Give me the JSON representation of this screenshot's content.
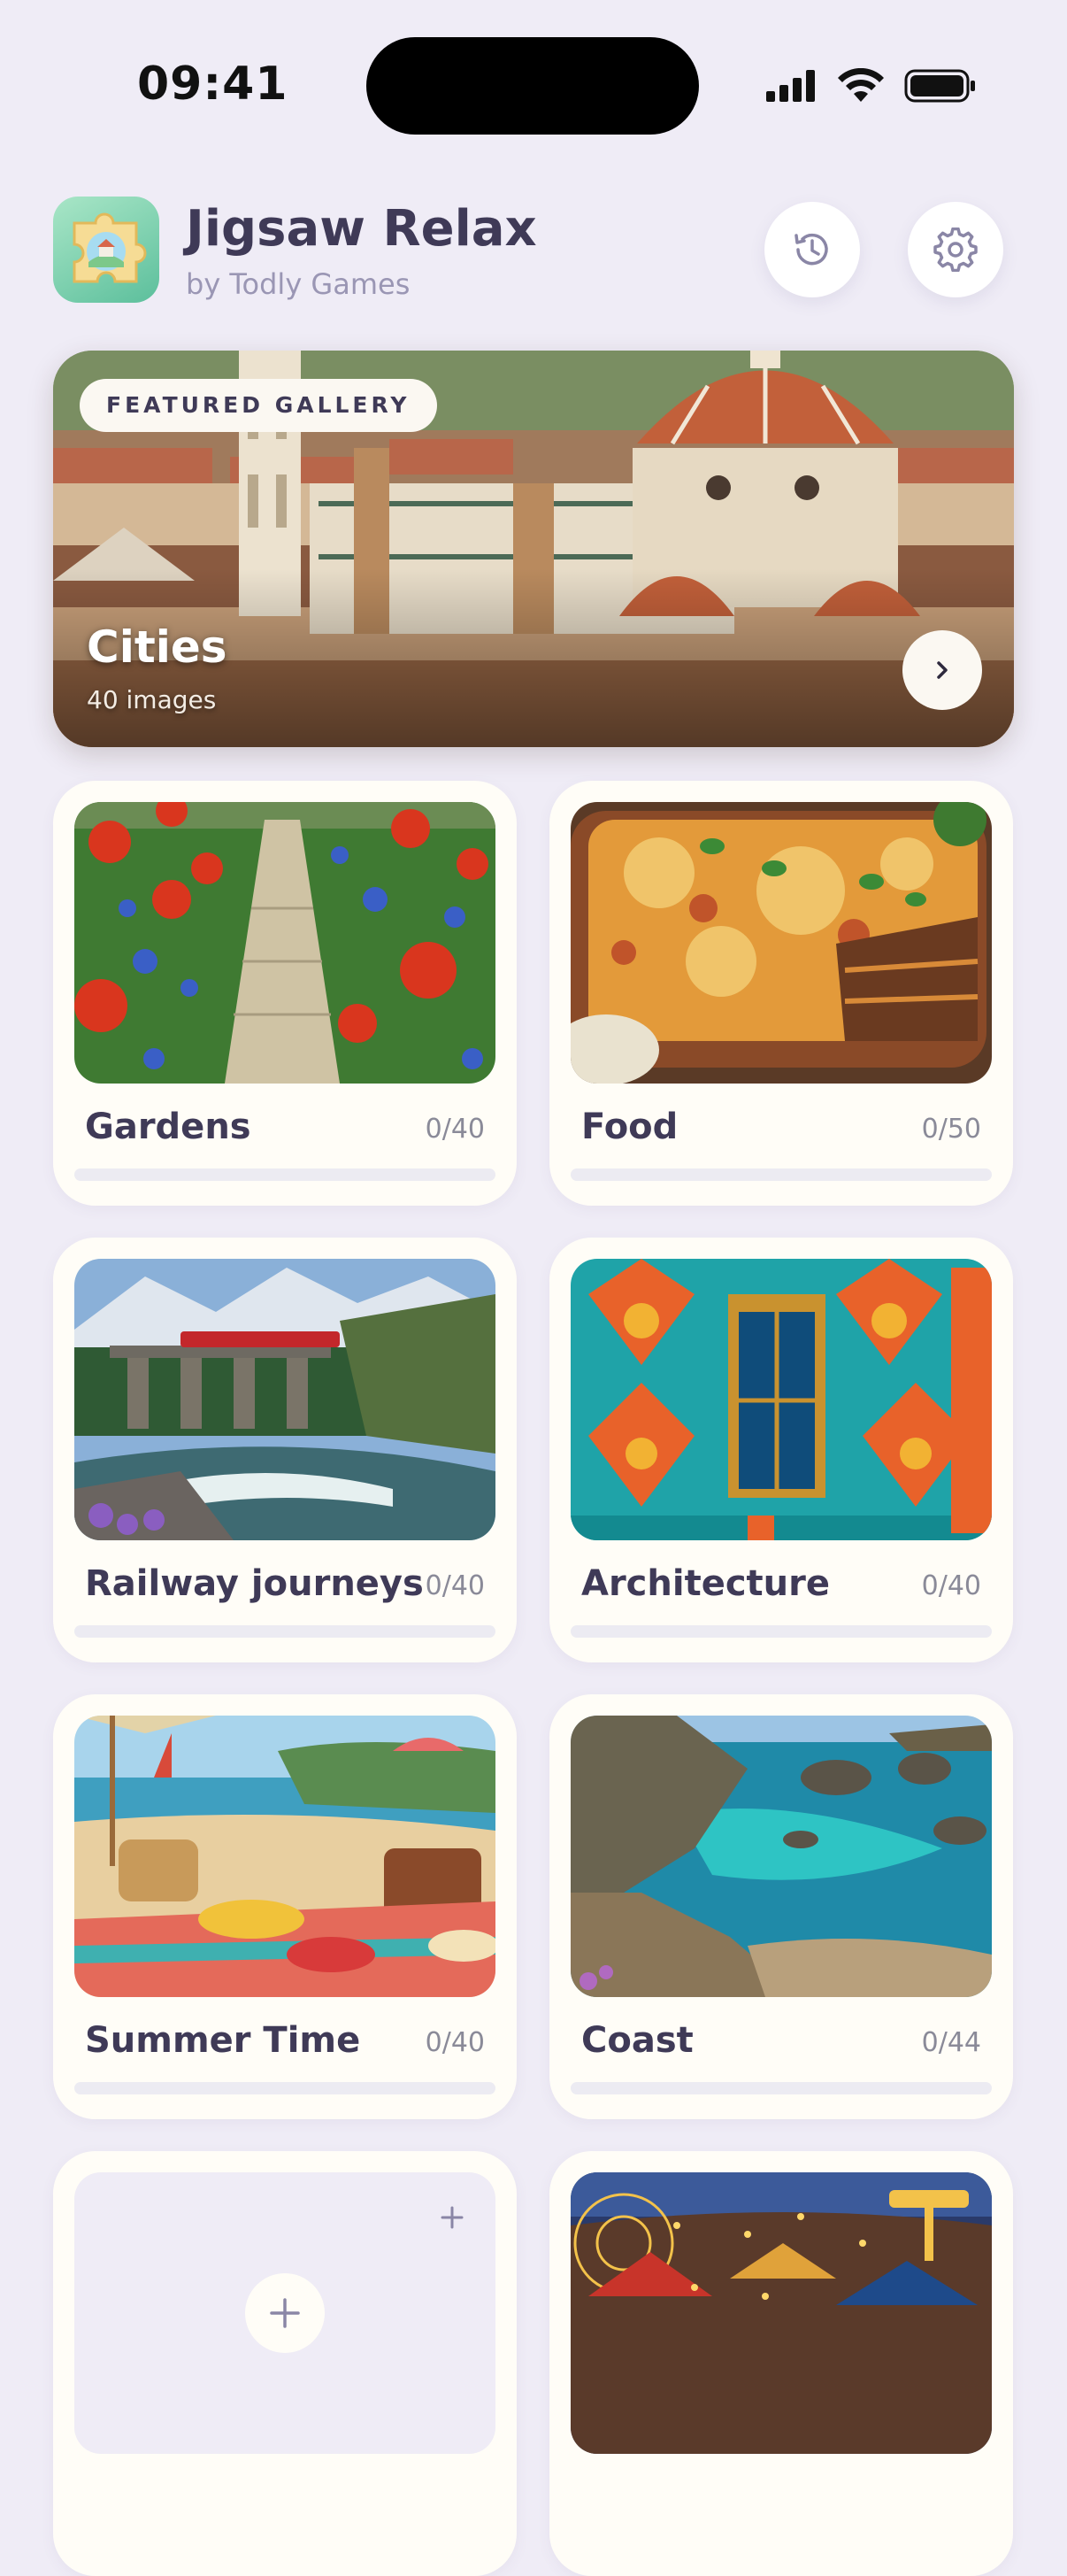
{
  "status_bar": {
    "time": "09:41"
  },
  "header": {
    "title": "Jigsaw Relax",
    "subtitle": "by Todly Games",
    "history_icon": "history-icon",
    "settings_icon": "gear-icon"
  },
  "featured": {
    "badge": "FEATURED GALLERY",
    "title": "Cities",
    "count": "40 images"
  },
  "galleries": [
    {
      "name": "Gardens",
      "progress": "0/40",
      "fraction": 0
    },
    {
      "name": "Food",
      "progress": "0/50",
      "fraction": 0
    },
    {
      "name": "Railway journeys",
      "progress": "0/40",
      "fraction": 0
    },
    {
      "name": "Architecture",
      "progress": "0/40",
      "fraction": 0
    },
    {
      "name": "Summer Time",
      "progress": "0/40",
      "fraction": 0
    },
    {
      "name": "Coast",
      "progress": "0/44",
      "fraction": 0
    }
  ],
  "colors": {
    "background": "#efecf6",
    "card": "#fffdf7",
    "text": "#3f3a57"
  }
}
